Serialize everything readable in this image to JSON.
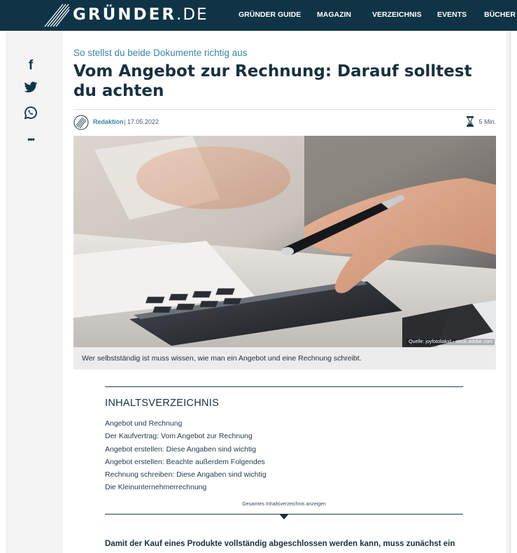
{
  "brand": {
    "name": "GRÜNDER",
    "tld": ".DE"
  },
  "nav": {
    "items": [
      {
        "label": "GRÜNDER GUIDE"
      },
      {
        "label": "MAGAZIN"
      },
      {
        "label": "VERZEICHNIS"
      },
      {
        "label": "EVENTS"
      },
      {
        "label": "BÜCHER"
      }
    ]
  },
  "share": {
    "icons": [
      "facebook-icon",
      "twitter-icon",
      "whatsapp-icon",
      "more-icon"
    ],
    "facebook_glyph": "f",
    "more_glyph": "•••"
  },
  "article": {
    "kicker": "So stellst du beide Dokumente richtig aus",
    "title": "Vom Angebot zur Rechnung: Darauf solltest du achten",
    "author": "Redaktion",
    "date_separator": "| 17.05.2022",
    "read_time": "5 Min.",
    "image_credit": "Quelle: joyfotoliakid - stock.adobe.com",
    "image_caption": "Wer selbstständig ist muss wissen, wie man ein Angebot und eine Rechnung schreibt.",
    "lead": "Damit der Kauf eines Produkte vollständig abgeschlossen werden kann, muss zunächst ein"
  },
  "toc": {
    "title": "INHALTSVERZEICHNIS",
    "items": [
      "Angebot und Rechnung",
      "Der Kaufvertrag: Vom Angebot zur Rechnung",
      "Angebot erstellen: Diese Angaben sind wichtig",
      "Angebot erstellen: Beachte außerdem Folgendes",
      "Rechnung schreiben: Diese Angaben sind wichtig",
      "Die Kleinunternehmerrechnung"
    ],
    "show_all": "Gesamtes Inhaltsverzeichnis anzeigen"
  },
  "colors": {
    "topbar": "#0f3446",
    "accent": "#3a84a6",
    "heading": "#16303f",
    "caption_bg": "#ececec"
  }
}
